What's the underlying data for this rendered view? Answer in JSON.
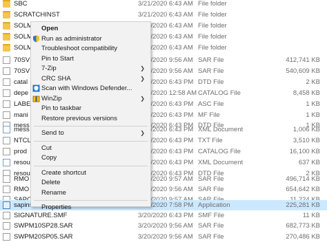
{
  "files": [
    {
      "name": "SBC",
      "date": "3/21/2020 6:43 AM",
      "type": "File folder",
      "size": "",
      "icon": "folder-icon"
    },
    {
      "name": "SCRATCHINST",
      "date": "3/21/2020 6:43 AM",
      "type": "File folder",
      "size": "",
      "icon": "folder-icon"
    },
    {
      "name": "SOLM",
      "date": "3/21/2020 6:43 AM",
      "type": "File folder",
      "size": "",
      "icon": "folder-icon"
    },
    {
      "name": "SOLM",
      "date": "3/21/2020 6:43 AM",
      "type": "File folder",
      "size": "",
      "icon": "folder-icon"
    },
    {
      "name": "SOLM",
      "date": "3/21/2020 6:43 AM",
      "type": "File folder",
      "size": "",
      "icon": "folder-icon"
    },
    {
      "name": "70SV",
      "date": "3/20/2020 9:56 AM",
      "type": "SAR File",
      "size": "412,741 KB",
      "icon": "file-icon"
    },
    {
      "name": "70SV",
      "date": "3/20/2020 9:56 AM",
      "type": "SAR File",
      "size": "540,609 KB",
      "icon": "file-icon"
    },
    {
      "name": "catal",
      "date": "3/21/2020 6:43 PM",
      "type": "DTD File",
      "size": "2 KB",
      "icon": "file-icon"
    },
    {
      "name": "depe",
      "date": "3/26/2020 12:58 AM",
      "type": "CATALOG File",
      "size": "8,458 KB",
      "icon": "file-icon"
    },
    {
      "name": "LABE",
      "date": "3/20/2020 6:43 PM",
      "type": "ASC File",
      "size": "1 KB",
      "icon": "file-icon"
    },
    {
      "name": "mani",
      "date": "3/20/2020 6:43 PM",
      "type": "MF File",
      "size": "1 KB",
      "icon": "file-icon"
    },
    {
      "name": "mess",
      "date": "3/20/2020 6:43 PM",
      "type": "DTD File",
      "size": "1 KB",
      "icon": "file-icon"
    },
    {
      "name": "mess",
      "date": "3/20/2020 6:43 PM",
      "type": "XML Document",
      "size": "1,006 KB",
      "icon": "xml-icon"
    },
    {
      "name": "NTCL",
      "date": "3/20/2020 6:43 PM",
      "type": "TXT File",
      "size": "3,510 KB",
      "icon": "file-icon"
    },
    {
      "name": "prod",
      "date": "3/20/2020 6:43 PM",
      "type": "CATALOG File",
      "size": "16,100 KB",
      "icon": "file-icon"
    },
    {
      "name": "resou",
      "date": "3/20/2020 6:43 PM",
      "type": "XML Document",
      "size": "637 KB",
      "icon": "xml-icon"
    },
    {
      "name": "resou",
      "date": "3/20/2020 6:43 PM",
      "type": "DTD File",
      "size": "2 KB",
      "icon": "file-icon"
    },
    {
      "name": "RMO",
      "date": "3/20/2020 9:57 AM",
      "type": "SAR File",
      "size": "496,714 KB",
      "icon": "file-icon"
    },
    {
      "name": "RMO",
      "date": "3/20/2020 9:56 AM",
      "type": "SAR File",
      "size": "654,642 KB",
      "icon": "file-icon"
    },
    {
      "name": "SAPC",
      "date": "3/20/2020 9:57 AM",
      "type": "SAR File",
      "size": "11,224 KB",
      "icon": "file-icon"
    },
    {
      "name": "sapinst",
      "date": "1/20/2020 7:58 PM",
      "type": "Application",
      "size": "225,281 KB",
      "icon": "app-icon",
      "selected": true
    },
    {
      "name": "SIGNATURE.SMF",
      "date": "3/20/2020 6:43 PM",
      "type": "SMF File",
      "size": "11 KB",
      "icon": "file-icon"
    },
    {
      "name": "SWPM10SP28.SAR",
      "date": "3/20/2020 9:56 AM",
      "type": "SAR File",
      "size": "682,773 KB",
      "icon": "file-icon"
    },
    {
      "name": "SWPM20SP05.SAR",
      "date": "3/20/2020 9:56 AM",
      "type": "SAR File",
      "size": "270,486 KB",
      "icon": "file-icon"
    }
  ],
  "context_menu": {
    "items": [
      {
        "label": "Open",
        "bold": true,
        "icon": "",
        "arrow": false,
        "name": "menu-open"
      },
      {
        "label": "Run as administrator",
        "bold": false,
        "icon": "shield-icon",
        "arrow": false,
        "name": "menu-run-as-administrator"
      },
      {
        "label": "Troubleshoot compatibility",
        "bold": false,
        "icon": "",
        "arrow": false,
        "name": "menu-troubleshoot-compatibility"
      },
      {
        "label": "Pin to Start",
        "bold": false,
        "icon": "",
        "arrow": false,
        "name": "menu-pin-to-start"
      },
      {
        "label": "7-Zip",
        "bold": false,
        "icon": "",
        "arrow": true,
        "name": "menu-7zip"
      },
      {
        "label": "CRC SHA",
        "bold": false,
        "icon": "",
        "arrow": true,
        "name": "menu-crc-sha"
      },
      {
        "label": "Scan with Windows Defender...",
        "bold": false,
        "icon": "defender-icon",
        "arrow": false,
        "name": "menu-scan-defender"
      },
      {
        "label": "WinZip",
        "bold": false,
        "icon": "winzip-icon",
        "arrow": true,
        "name": "menu-winzip"
      },
      {
        "label": "Pin to taskbar",
        "bold": false,
        "icon": "",
        "arrow": false,
        "name": "menu-pin-to-taskbar"
      },
      {
        "label": "Restore previous versions",
        "bold": false,
        "icon": "",
        "arrow": false,
        "name": "menu-restore-previous-versions"
      },
      {
        "sep": true
      },
      {
        "label": "Send to",
        "bold": false,
        "icon": "",
        "arrow": true,
        "name": "menu-send-to"
      },
      {
        "sep": true
      },
      {
        "label": "Cut",
        "bold": false,
        "icon": "",
        "arrow": false,
        "name": "menu-cut"
      },
      {
        "label": "Copy",
        "bold": false,
        "icon": "",
        "arrow": false,
        "name": "menu-copy"
      },
      {
        "sep": true
      },
      {
        "label": "Create shortcut",
        "bold": false,
        "icon": "",
        "arrow": false,
        "name": "menu-create-shortcut"
      },
      {
        "label": "Delete",
        "bold": false,
        "icon": "",
        "arrow": false,
        "name": "menu-delete"
      },
      {
        "label": "Rename",
        "bold": false,
        "icon": "",
        "arrow": false,
        "name": "menu-rename"
      },
      {
        "sep": true
      },
      {
        "label": "Properties",
        "bold": false,
        "icon": "",
        "arrow": false,
        "name": "menu-properties"
      }
    ]
  },
  "colors": {
    "selection": "#cce8ff",
    "menu_bg": "#f2f2f2",
    "folder": "#f4c64d"
  }
}
